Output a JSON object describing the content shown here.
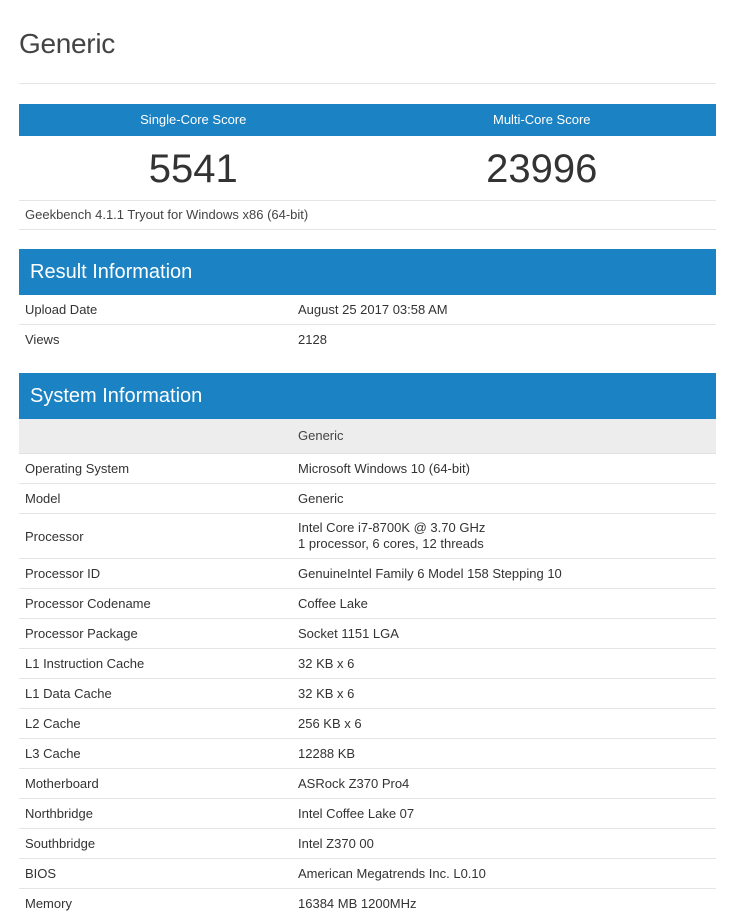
{
  "page": {
    "title": "Generic"
  },
  "scores": {
    "single_label": "Single-Core Score",
    "multi_label": "Multi-Core Score",
    "single_value": "5541",
    "multi_value": "23996",
    "platform": "Geekbench 4.1.1 Tryout for Windows x86 (64-bit)"
  },
  "result_info": {
    "heading": "Result Information",
    "rows": [
      {
        "key": "Upload Date",
        "value": "August 25 2017 03:58 AM"
      },
      {
        "key": "Views",
        "value": "2128"
      }
    ]
  },
  "system_info": {
    "heading": "System Information",
    "column_header": "Generic",
    "rows": [
      {
        "key": "Operating System",
        "value": "Microsoft Windows 10 (64-bit)"
      },
      {
        "key": "Model",
        "value": "Generic"
      },
      {
        "key": "Processor",
        "value": "Intel Core i7-8700K @ 3.70 GHz",
        "value2": "1 processor, 6 cores, 12 threads"
      },
      {
        "key": "Processor ID",
        "value": "GenuineIntel Family 6 Model 158 Stepping 10"
      },
      {
        "key": "Processor Codename",
        "value": "Coffee Lake"
      },
      {
        "key": "Processor Package",
        "value": "Socket 1151 LGA"
      },
      {
        "key": "L1 Instruction Cache",
        "value": "32 KB x 6"
      },
      {
        "key": "L1 Data Cache",
        "value": "32 KB x 6"
      },
      {
        "key": "L2 Cache",
        "value": "256 KB x 6"
      },
      {
        "key": "L3 Cache",
        "value": "12288 KB"
      },
      {
        "key": "Motherboard",
        "value": "ASRock Z370 Pro4"
      },
      {
        "key": "Northbridge",
        "value": "Intel Coffee Lake 07"
      },
      {
        "key": "Southbridge",
        "value": "Intel Z370 00"
      },
      {
        "key": "BIOS",
        "value": "American Megatrends Inc. L0.10"
      },
      {
        "key": "Memory",
        "value": "16384 MB 1200MHz"
      }
    ]
  },
  "colors": {
    "accent": "#1b82c3",
    "subheader_bg": "#ededed",
    "rule": "#e5e5e5"
  }
}
